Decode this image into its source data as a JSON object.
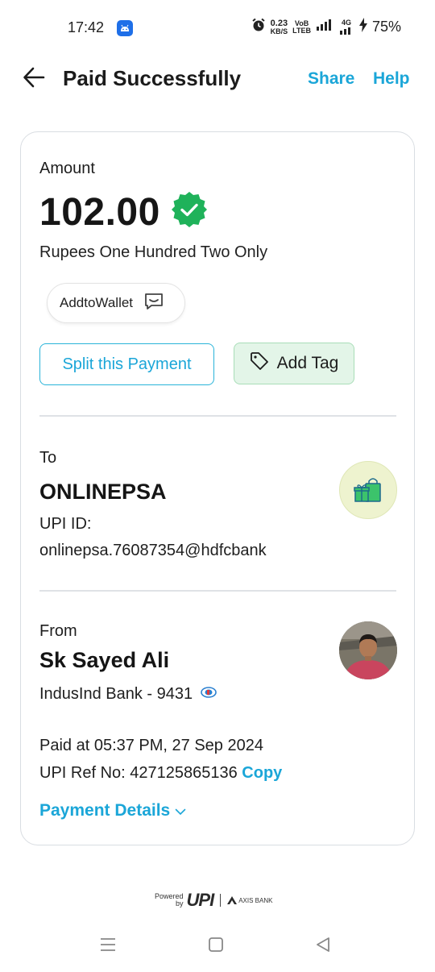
{
  "status_bar": {
    "time": "17:42",
    "net_speed_value": "0.23",
    "net_speed_unit": "KB/S",
    "volte_top": "VoB",
    "volte_bottom": "LTEB",
    "network": "4G",
    "battery": "75%"
  },
  "header": {
    "title": "Paid Successfully",
    "share_label": "Share",
    "help_label": "Help"
  },
  "payment": {
    "amount_label": "Amount",
    "amount": "102.00",
    "amount_words": "Rupees One Hundred Two Only",
    "note": "AddtoWallet",
    "split_label": "Split this Payment",
    "add_tag_label": "Add Tag"
  },
  "to": {
    "label": "To",
    "name": "ONLINEPSA",
    "upi_label": "UPI ID:",
    "upi_id": "onlinepsa.76087354@hdfcbank"
  },
  "from": {
    "label": "From",
    "name": "Sk Sayed Ali",
    "bank": "IndusInd Bank - 9431",
    "paid_at": "Paid at 05:37 PM, 27 Sep 2024",
    "ref_label": "UPI Ref No: 427125865136",
    "copy_label": "Copy",
    "details_label": "Payment Details"
  },
  "footer": {
    "powered_line1": "Powered",
    "powered_line2": "by",
    "upi": "UPI",
    "bank": "AXIS BANK"
  },
  "colors": {
    "accent": "#1ba6d8",
    "verified": "#1fb25a",
    "tag_bg": "#e3f5e8"
  }
}
